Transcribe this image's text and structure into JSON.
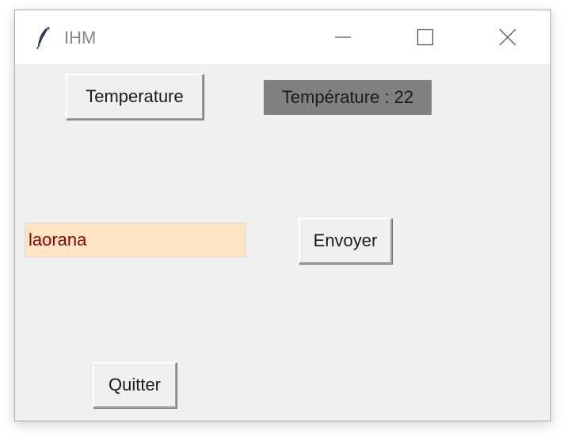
{
  "window": {
    "title": "IHM",
    "controls": {
      "minimize_icon": "minimize-icon",
      "maximize_icon": "maximize-icon",
      "close_icon": "close-icon"
    }
  },
  "main": {
    "temperature_button_label": "Temperature",
    "temperature_display": "Température : 22",
    "entry_value": "laorana",
    "send_button_label": "Envoyer",
    "quit_button_label": "Quitter"
  },
  "colors": {
    "window_background": "#f0f0f0",
    "temperature_label_background": "#808080",
    "entry_background": "#ffe4c4",
    "entry_text": "#8b0000"
  }
}
